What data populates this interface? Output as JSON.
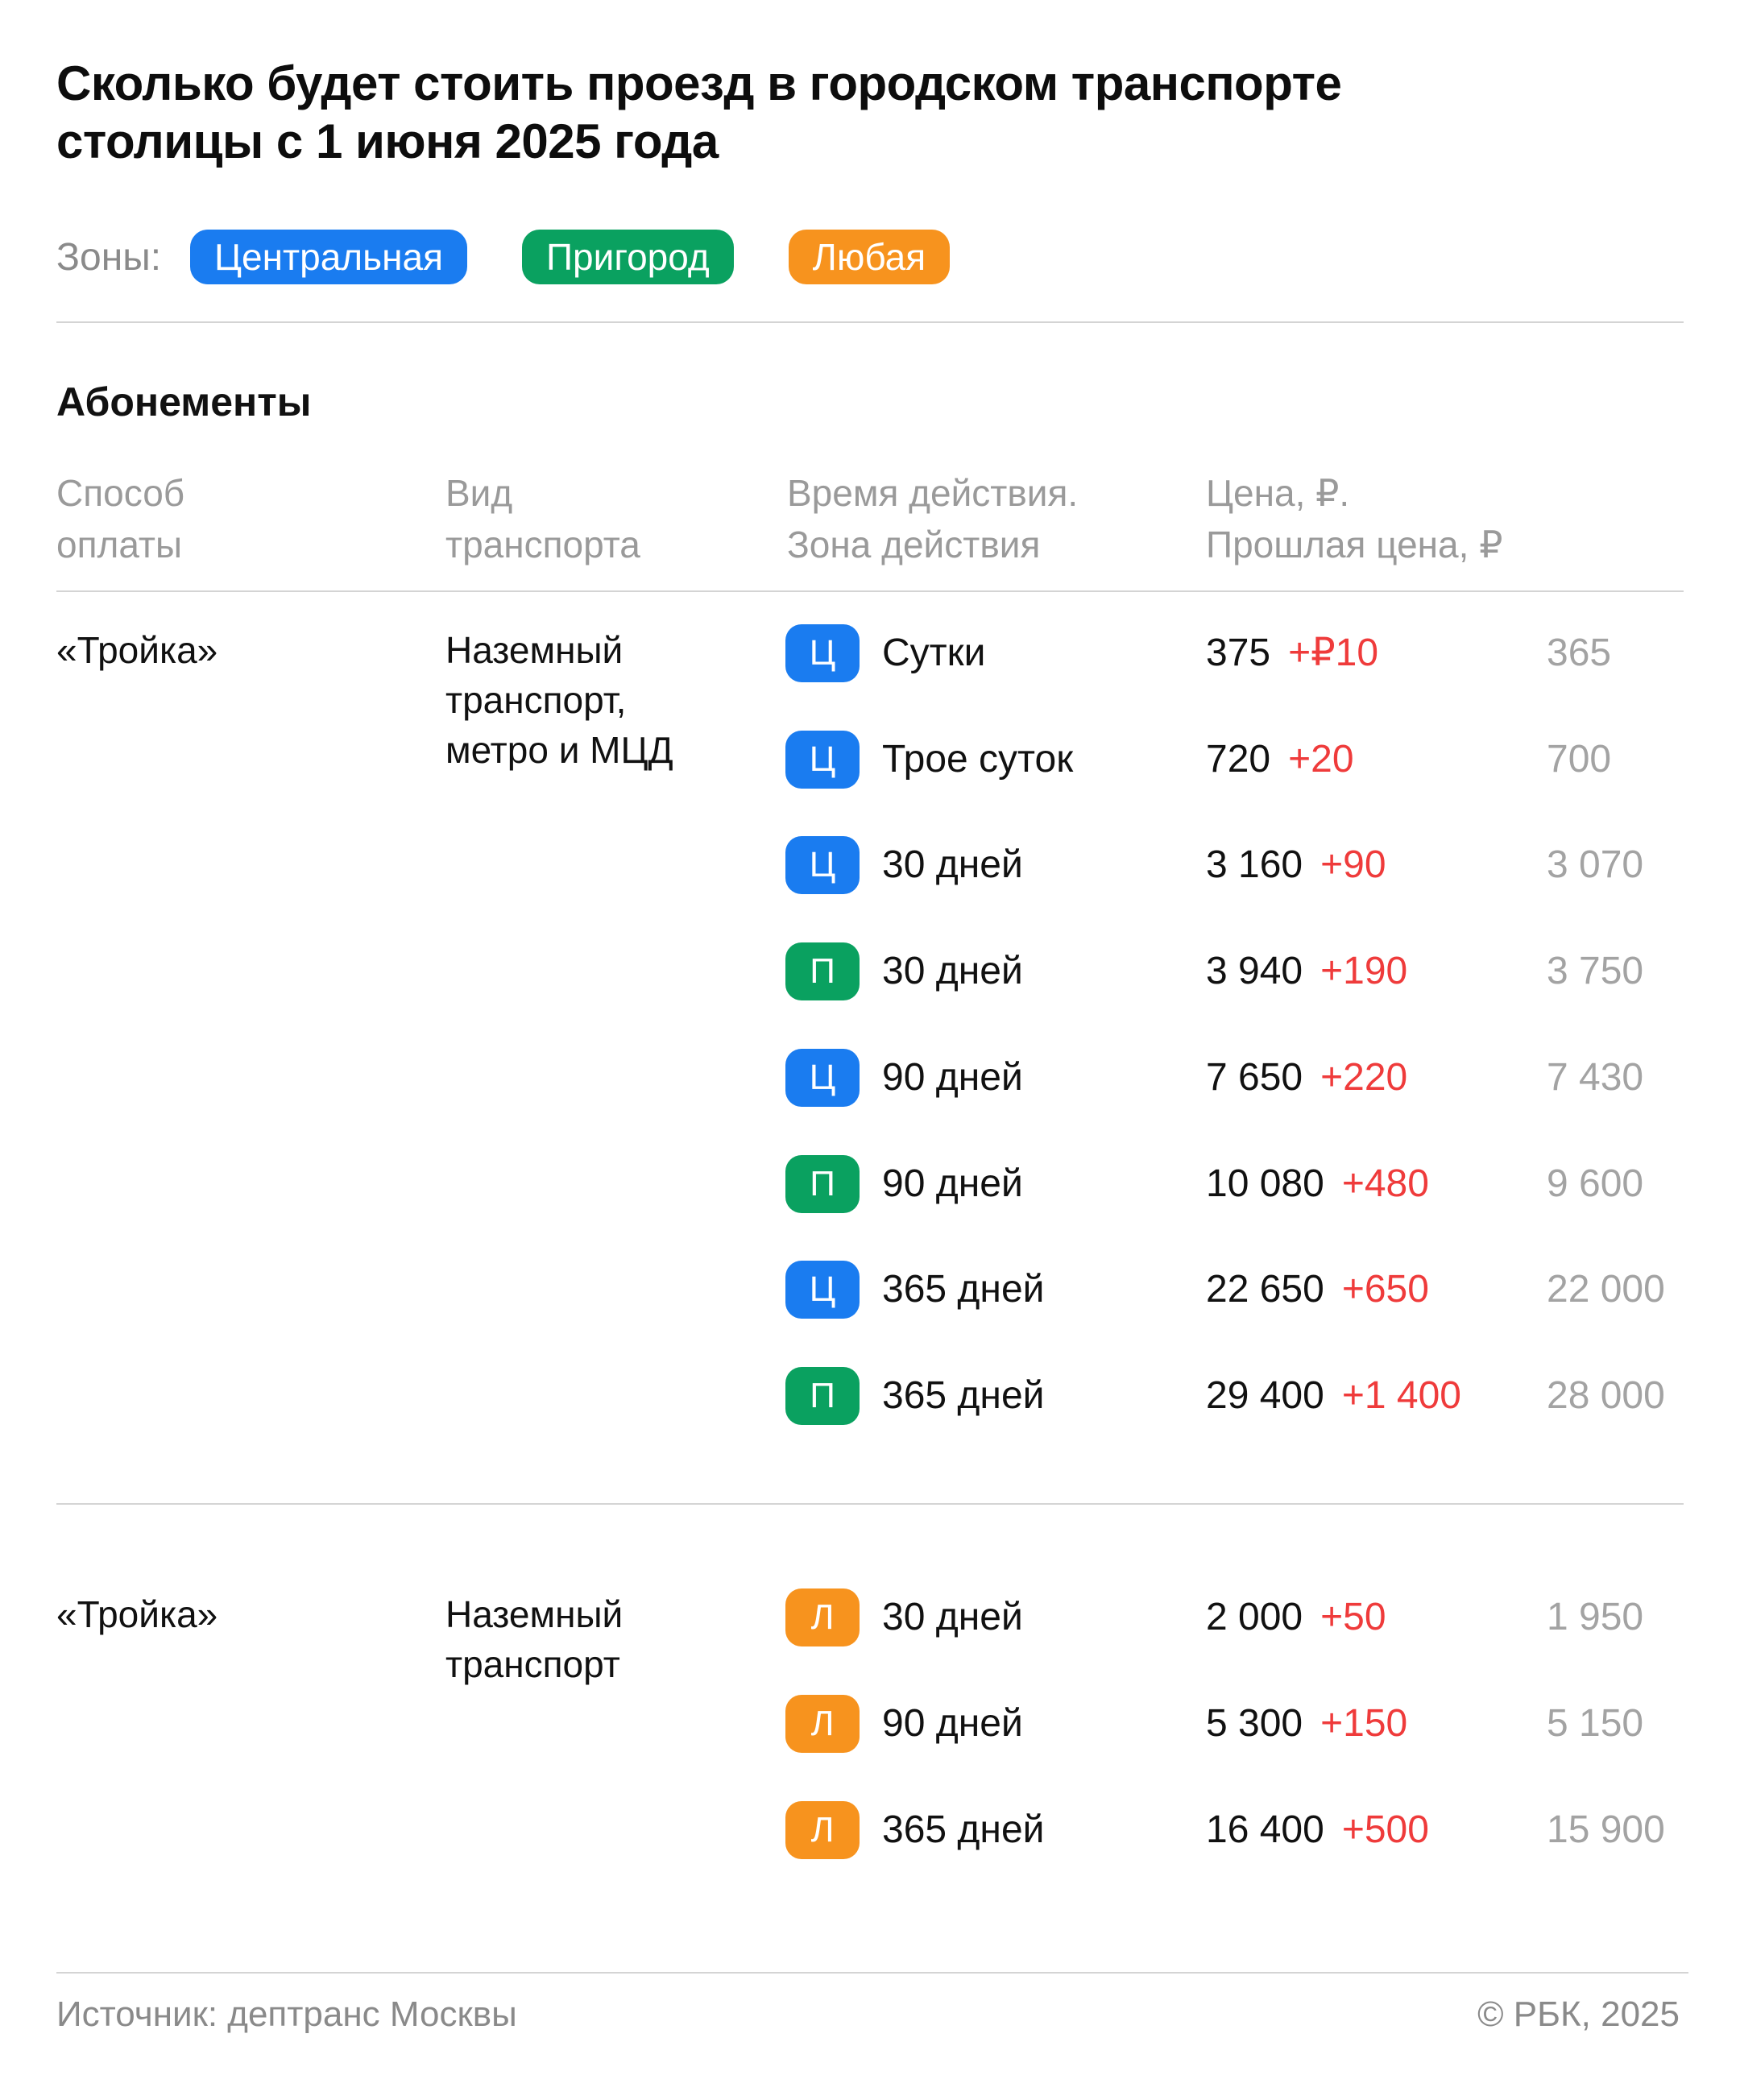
{
  "title": {
    "line1": "Сколько будет стоить проезд в городском транспорте",
    "line2": "столицы с 1 июня 2025 года"
  },
  "zones": {
    "label": "Зоны:",
    "items": [
      {
        "label": "Центральная",
        "color": "#1a7cf0"
      },
      {
        "label": "Пригород",
        "color": "#0aa160"
      },
      {
        "label": "Любая",
        "color": "#f7931e"
      }
    ]
  },
  "section_title": "Абонементы",
  "columns": {
    "payment": [
      "Способ",
      "оплаты"
    ],
    "transport": [
      "Вид",
      "транспорта"
    ],
    "validity": [
      "Время действия.",
      "Зона действия"
    ],
    "price": [
      "Цена, ₽.",
      "Прошлая цена, ₽"
    ]
  },
  "colors": {
    "central": "#1a7cf0",
    "suburb": "#0aa160",
    "any": "#f7931e",
    "increase": "#ef3b3b"
  },
  "groups": [
    {
      "payment": "«Тройка»",
      "transport": [
        "Наземный",
        "транспорт,",
        "метро и МЦД"
      ],
      "rows": [
        {
          "zone": "Ц",
          "zone_color": "#1a7cf0",
          "duration": "Сутки",
          "price": "375",
          "delta": "+₽10",
          "old": "365"
        },
        {
          "zone": "Ц",
          "zone_color": "#1a7cf0",
          "duration": "Трое суток",
          "price": "720",
          "delta": "+20",
          "old": "700"
        },
        {
          "zone": "Ц",
          "zone_color": "#1a7cf0",
          "duration": "30 дней",
          "price": "3 160",
          "delta": "+90",
          "old": "3 070"
        },
        {
          "zone": "П",
          "zone_color": "#0aa160",
          "duration": "30 дней",
          "price": "3 940",
          "delta": "+190",
          "old": "3 750"
        },
        {
          "zone": "Ц",
          "zone_color": "#1a7cf0",
          "duration": "90 дней",
          "price": "7 650",
          "delta": "+220",
          "old": "7 430"
        },
        {
          "zone": "П",
          "zone_color": "#0aa160",
          "duration": "90 дней",
          "price": "10 080",
          "delta": "+480",
          "old": "9 600"
        },
        {
          "zone": "Ц",
          "zone_color": "#1a7cf0",
          "duration": "365 дней",
          "price": "22 650",
          "delta": "+650",
          "old": "22 000"
        },
        {
          "zone": "П",
          "zone_color": "#0aa160",
          "duration": "365 дней",
          "price": "29 400",
          "delta": "+1 400",
          "old": "28 000"
        }
      ]
    },
    {
      "payment": "«Тройка»",
      "transport": [
        "Наземный",
        "транспорт"
      ],
      "rows": [
        {
          "zone": "Л",
          "zone_color": "#f7931e",
          "duration": "30 дней",
          "price": "2 000",
          "delta": "+50",
          "old": "1 950"
        },
        {
          "zone": "Л",
          "zone_color": "#f7931e",
          "duration": "90 дней",
          "price": "5 300",
          "delta": "+150",
          "old": "5 150"
        },
        {
          "zone": "Л",
          "zone_color": "#f7931e",
          "duration": "365 дней",
          "price": "16 400",
          "delta": "+500",
          "old": "15 900"
        }
      ]
    }
  ],
  "footer": {
    "source": "Источник: дептранс Москвы",
    "copyright": "© РБК, 2025"
  }
}
